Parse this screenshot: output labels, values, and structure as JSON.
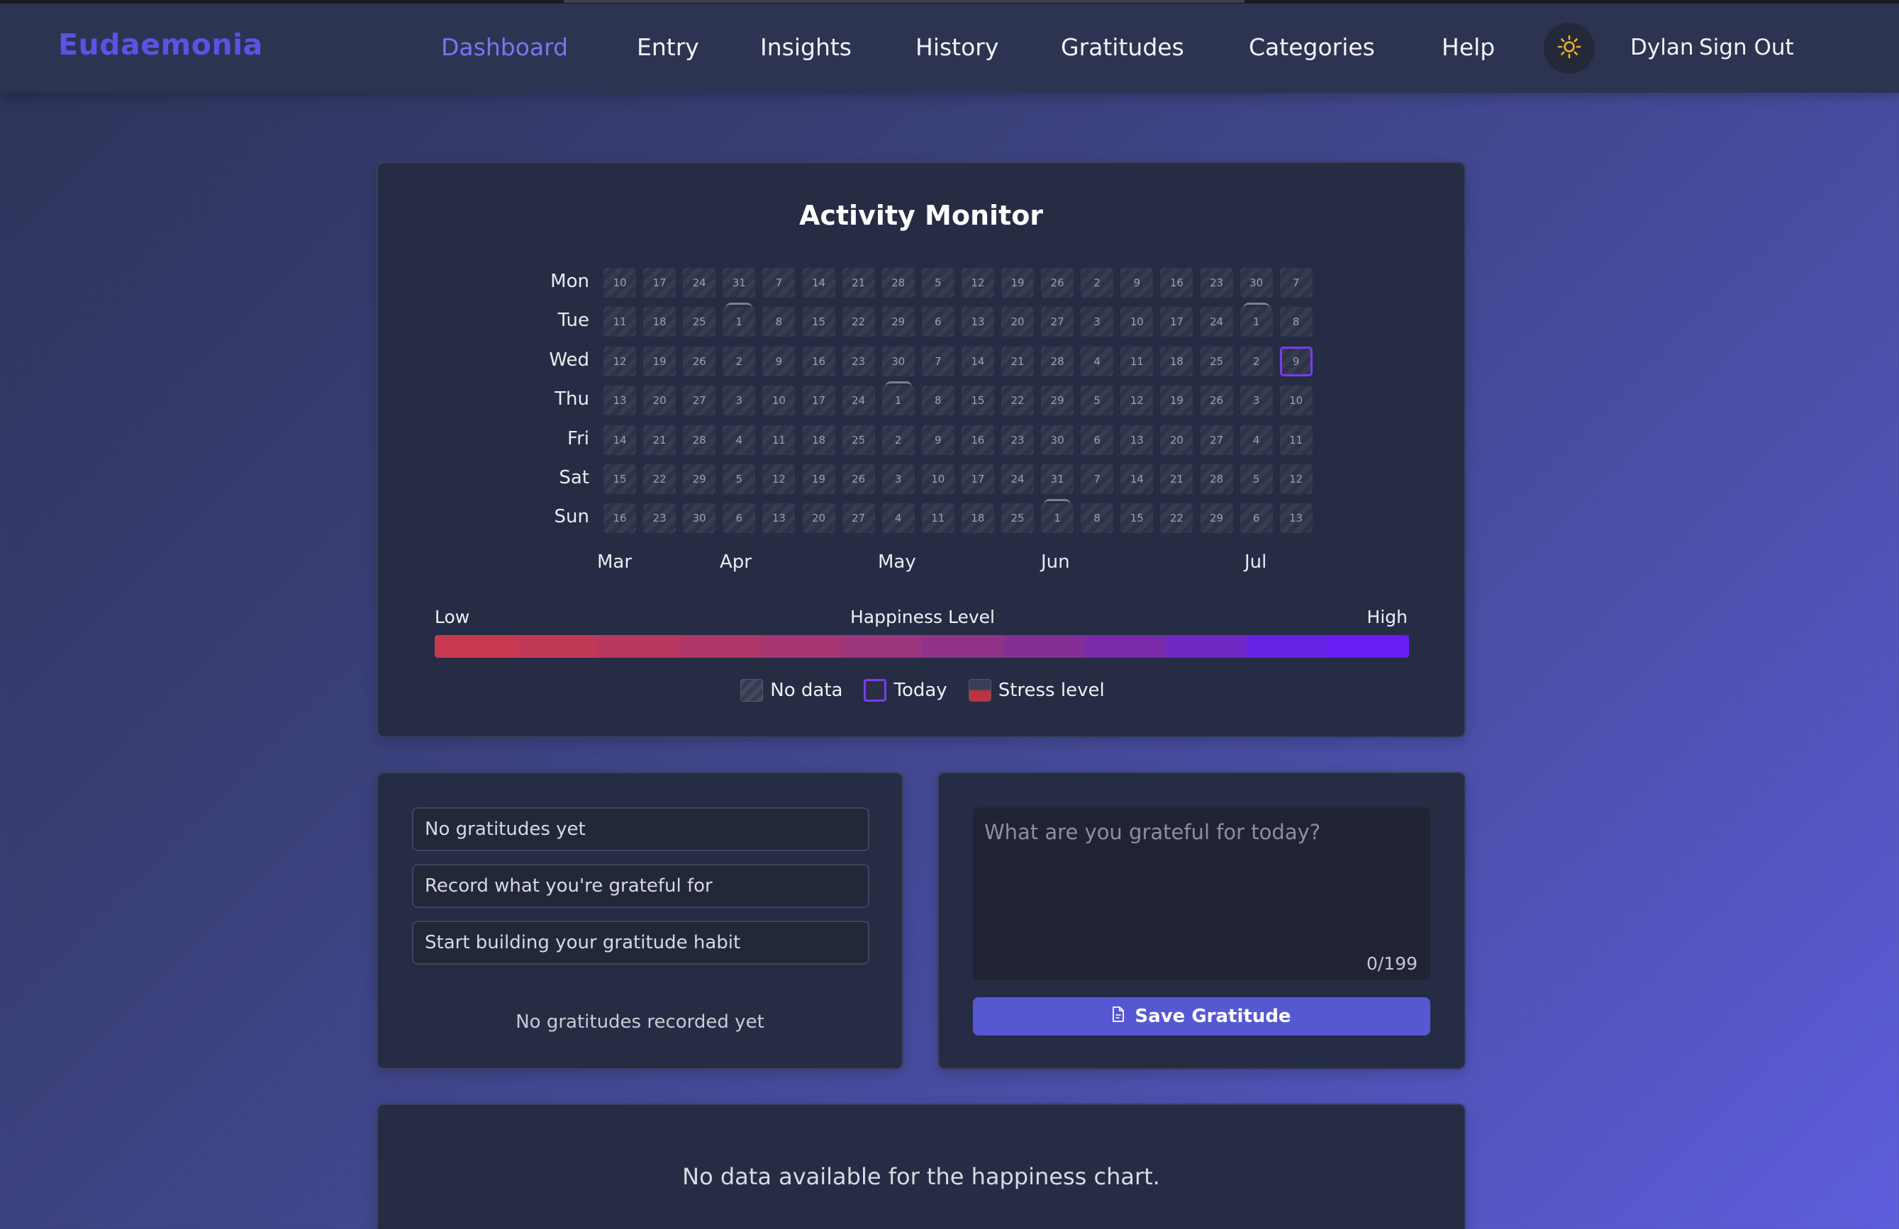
{
  "app": {
    "brand": "Eudaemonia"
  },
  "nav": {
    "items": [
      {
        "label": "Dashboard",
        "active": true
      },
      {
        "label": "Entry"
      },
      {
        "label": "Insights"
      },
      {
        "label": "History"
      },
      {
        "label": "Gratitudes"
      },
      {
        "label": "Categories"
      },
      {
        "label": "Help"
      }
    ],
    "theme_icon": "sun-icon",
    "user": "Dylan",
    "sign_out": "Sign Out"
  },
  "activity": {
    "title": "Activity Monitor",
    "days": [
      "Mon",
      "Tue",
      "Wed",
      "Thu",
      "Fri",
      "Sat",
      "Sun"
    ],
    "weeks": [
      [
        "10",
        "11",
        "12",
        "13",
        "14",
        "15",
        "16"
      ],
      [
        "17",
        "18",
        "19",
        "20",
        "21",
        "22",
        "23"
      ],
      [
        "24",
        "25",
        "26",
        "27",
        "28",
        "29",
        "30"
      ],
      [
        "31",
        "1",
        "2",
        "3",
        "4",
        "5",
        "6"
      ],
      [
        "7",
        "8",
        "9",
        "10",
        "11",
        "12",
        "13"
      ],
      [
        "14",
        "15",
        "16",
        "17",
        "18",
        "19",
        "20"
      ],
      [
        "21",
        "22",
        "23",
        "24",
        "25",
        "26",
        "27"
      ],
      [
        "28",
        "29",
        "30",
        "1",
        "2",
        "3",
        "4"
      ],
      [
        "5",
        "6",
        "7",
        "8",
        "9",
        "10",
        "11"
      ],
      [
        "12",
        "13",
        "14",
        "15",
        "16",
        "17",
        "18"
      ],
      [
        "19",
        "20",
        "21",
        "22",
        "23",
        "24",
        "25"
      ],
      [
        "26",
        "27",
        "28",
        "29",
        "30",
        "31",
        "1"
      ],
      [
        "2",
        "3",
        "4",
        "5",
        "6",
        "7",
        "8"
      ],
      [
        "9",
        "10",
        "11",
        "12",
        "13",
        "14",
        "15"
      ],
      [
        "16",
        "17",
        "18",
        "19",
        "20",
        "21",
        "22"
      ],
      [
        "23",
        "24",
        "25",
        "26",
        "27",
        "28",
        "29"
      ],
      [
        "30",
        "1",
        "2",
        "3",
        "4",
        "5",
        "6"
      ],
      [
        "7",
        "8",
        "9",
        "10",
        "11",
        "12",
        "13"
      ]
    ],
    "months": [
      "Mar",
      "Apr",
      "May",
      "Jun",
      "Jul"
    ],
    "today": "9",
    "scale": {
      "low": "Low",
      "label": "Happiness Level",
      "high": "High",
      "colors": [
        "#c8384f",
        "#c23857",
        "#b8385f",
        "#b03868",
        "#a83672",
        "#9c347e",
        "#90328a",
        "#842f96",
        "#7a2ca8",
        "#6e28c4",
        "#6623e6",
        "#6a1cf5"
      ]
    },
    "legend": [
      {
        "label": "No data"
      },
      {
        "label": "Today"
      },
      {
        "label": "Stress level"
      }
    ]
  },
  "gratitudes": {
    "items": [
      "No gratitudes yet",
      "Record what you're grateful for",
      "Start building your gratitude habit"
    ],
    "empty_message": "No gratitudes recorded yet",
    "input_placeholder": "What are you grateful for today?",
    "counter": "0/199",
    "save_label": "Save Gratitude"
  },
  "happiness_chart": {
    "empty_message": "No data available for the happiness chart."
  }
}
